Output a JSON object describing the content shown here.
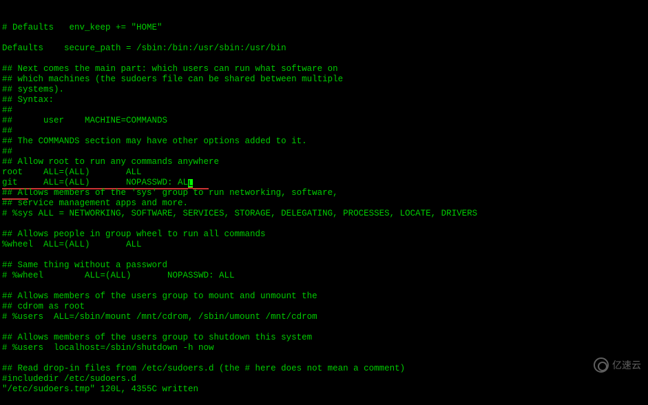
{
  "file_content": {
    "lines": [
      "# Defaults   env_keep += \"HOME\"",
      "",
      "Defaults    secure_path = /sbin:/bin:/usr/sbin:/usr/bin",
      "",
      "## Next comes the main part: which users can run what software on",
      "## which machines (the sudoers file can be shared between multiple",
      "## systems).",
      "## Syntax:",
      "##",
      "##      user    MACHINE=COMMANDS",
      "##",
      "## The COMMANDS section may have other options added to it.",
      "##",
      "## Allow root to run any commands anywhere",
      "root    ALL=(ALL)       ALL"
    ],
    "cursor_line_before": "git     ALL=(ALL)       NOPASSWD: AL",
    "cursor_line_after_underline": "   ",
    "lines_after": [
      "## Allows members of the 'sys' group to run networking, software,",
      "## service management apps and more.",
      "# %sys ALL = NETWORKING, SOFTWARE, SERVICES, STORAGE, DELEGATING, PROCESSES, LOCATE, DRIVERS",
      "",
      "## Allows people in group wheel to run all commands",
      "%wheel  ALL=(ALL)       ALL",
      "",
      "## Same thing without a password",
      "# %wheel        ALL=(ALL)       NOPASSWD: ALL",
      "",
      "## Allows members of the users group to mount and unmount the",
      "## cdrom as root",
      "# %users  ALL=/sbin/mount /mnt/cdrom, /sbin/umount /mnt/cdrom",
      "",
      "## Allows members of the users group to shutdown this system",
      "# %users  localhost=/sbin/shutdown -h now",
      "",
      "## Read drop-in files from /etc/sudoers.d (the # here does not mean a comment)",
      "#includedir /etc/sudoers.d"
    ],
    "status_line": "\"/etc/sudoers.tmp\" 120L, 4355C written"
  },
  "underline_start_part": "git     ALL=(ALL)       NOPASSWD: AL",
  "underline_next_line_prefix": "## Al",
  "underline_next_line_suffix": "lows members of the 'sys' group to run networking, software,",
  "watermark_text": "亿速云"
}
